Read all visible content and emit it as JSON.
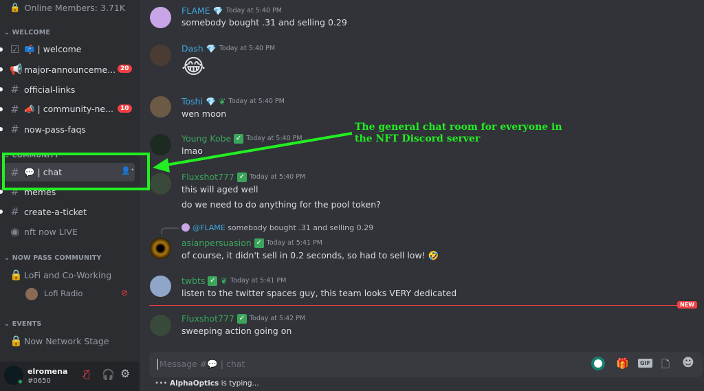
{
  "sidebar": {
    "online_members": "Online Members: 3.71K",
    "categories": {
      "welcome": "WELCOME",
      "community": "COMMUNITY",
      "now_pass": "NOW PASS COMMUNITY",
      "events": "EVENTS"
    },
    "channels": {
      "welcome": "📫 | welcome",
      "major": "major-announceme...",
      "major_badge": "20",
      "official": "official-links",
      "community_news": "📣 | community-ne...",
      "community_badge": "10",
      "faqs": "now-pass-faqs",
      "chat": "💬 | chat",
      "memes": "memes",
      "ticket": "create-a-ticket",
      "live": "nft now LIVE",
      "lofi": "LoFi and Co-Working",
      "lofi_radio": "Lofi Radio",
      "stage": "Now Network Stage"
    },
    "user": {
      "name": "elromena",
      "tag": "#0650"
    }
  },
  "messages": [
    {
      "author": "FLAME",
      "time": "Today at 5:40 PM",
      "text": "somebody bought .31 and selling 0.29"
    },
    {
      "author": "Dash",
      "time": "Today at 5:40 PM",
      "text": "😂"
    },
    {
      "author": "Toshi",
      "time": "Today at 5:40 PM",
      "text": "wen moon"
    },
    {
      "author": "Young Kobe",
      "time": "Today at 5:40 PM",
      "text": "lmao"
    },
    {
      "author": "Fluxshot777",
      "time": "Today at 5:40 PM",
      "text": "this will aged well",
      "text2": "do we need to do anything for the pool token?"
    },
    {
      "reply_to": "@FLAME",
      "reply_text": "somebody bought .31 and selling 0.29",
      "author": "asianpersuasion",
      "time": "Today at 5:41 PM",
      "text": "of course, it didn't sell in 0.2 seconds, so had to sell low!  🤣"
    },
    {
      "author": "twbts",
      "time": "Today at 5:41 PM",
      "text": "listen to the twitter spaces guy, this team looks VERY dedicated"
    },
    {
      "author": "Fluxshot777",
      "time": "Today at 5:42 PM",
      "text": "sweeping action going on"
    }
  ],
  "new_label": "NEW",
  "composer": {
    "placeholder": "Message #💬 | chat",
    "gif": "GIF"
  },
  "typing": {
    "user": "AlphaOptics",
    "text": " is typing..."
  },
  "annotation": {
    "text": "The general chat room for everyone in the NFT Discord server",
    "color": "#22ee22"
  },
  "colors": {
    "sidebar": "#2b2d31",
    "chat": "#313338",
    "mention_blue": "#3fa7df",
    "green_role": "#3ba55c",
    "badge": "#f23f43"
  }
}
